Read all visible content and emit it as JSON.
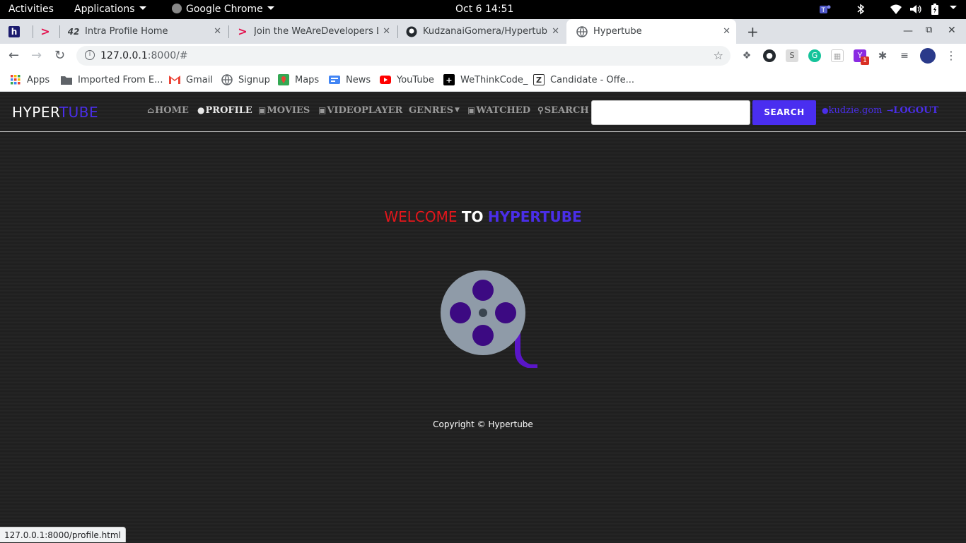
{
  "system_bar": {
    "activities": "Activities",
    "applications": "Applications",
    "app_name": "Google Chrome",
    "datetime": "Oct 6  14:51"
  },
  "tabs": [
    {
      "label": "",
      "favicon_text": "h",
      "favicon_color": "#1c1c6e"
    },
    {
      "label": "",
      "favicon_text": ">",
      "favicon_color": "#e3114d"
    },
    {
      "label": "Intra Profile Home",
      "favicon_text": "42",
      "favicon_color": "#000000"
    },
    {
      "label": "Join the WeAreDevelopers Li",
      "favicon_text": ">",
      "favicon_color": "#e3114d"
    },
    {
      "label": "KudzanaiGomera/Hypertube:",
      "favicon_text": "gh",
      "favicon_color": "#000000"
    },
    {
      "label": "Hypertube",
      "favicon_text": "globe",
      "favicon_color": "#5f6368"
    }
  ],
  "toolbar": {
    "url_host": "127.0.0.1",
    "url_path": ":8000/#"
  },
  "bookmarks": [
    {
      "label": "Apps"
    },
    {
      "label": "Imported From E..."
    },
    {
      "label": "Gmail"
    },
    {
      "label": "Signup"
    },
    {
      "label": "Maps"
    },
    {
      "label": "News"
    },
    {
      "label": "YouTube"
    },
    {
      "label": "WeThinkCode_"
    },
    {
      "label": "Candidate - Offe..."
    }
  ],
  "site": {
    "brand_part1": "HYPER",
    "brand_part2": "TUBE",
    "nav": {
      "home": "HOME",
      "profile": "PROFILE",
      "movies": "MOVIES",
      "videoplayer": "VIDEOPLAYER",
      "genres": "GENRES",
      "watched": "WATCHED",
      "search": "SEARCH"
    },
    "search_input_value": "",
    "search_button": "SEARCH",
    "username": "kudzie.gom",
    "logout": "LOGOUT",
    "welcome_1": "WELCOME",
    "welcome_2": "TO",
    "welcome_3": "HYPERTUBE",
    "copyright": "Copyright © Hypertube",
    "accent_color": "#4a2ee8",
    "welcome_red": "#e3161b"
  },
  "status_url": "127.0.0.1:8000/profile.html"
}
